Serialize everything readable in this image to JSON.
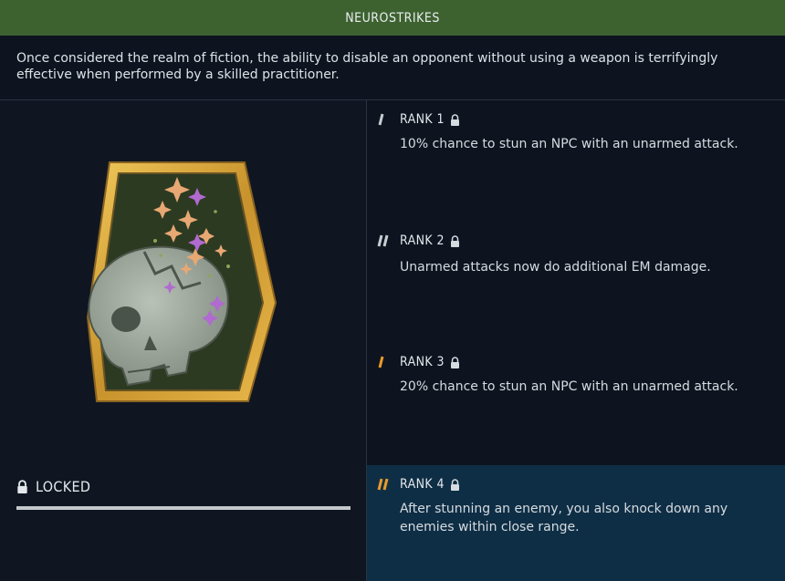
{
  "header": {
    "title": "NEUROSTRIKES"
  },
  "perk": {
    "description": "Once considered the realm of fiction, the ability to disable an opponent without using a weapon is terrifyingly effective when performed by a skilled practitioner.",
    "status_label": "LOCKED",
    "progress_fraction": 0
  },
  "ranks": [
    {
      "label": "RANK 1",
      "description": "10% chance to stun an NPC with an unarmed attack.",
      "tally_color": "#c9ccd0"
    },
    {
      "label": "RANK 2",
      "description": "Unarmed attacks now do additional EM damage.",
      "tally_color": "#c9ccd0"
    },
    {
      "label": "RANK 3",
      "description": "20% chance to stun an NPC with an unarmed attack.",
      "tally_color": "#e89a2a"
    },
    {
      "label": "RANK 4",
      "description": "After stunning an enemy, you also knock down any enemies within close range.",
      "tally_color": "#e89a2a"
    }
  ],
  "icons": {
    "lock": "lock-icon",
    "badge": "skull-stars-badge"
  },
  "colors": {
    "header_bg": "#3d6230",
    "active_rank_bg": "#0e2e45",
    "rank_accent": "#e89a2a",
    "badge_gold": "#d4a53a"
  }
}
